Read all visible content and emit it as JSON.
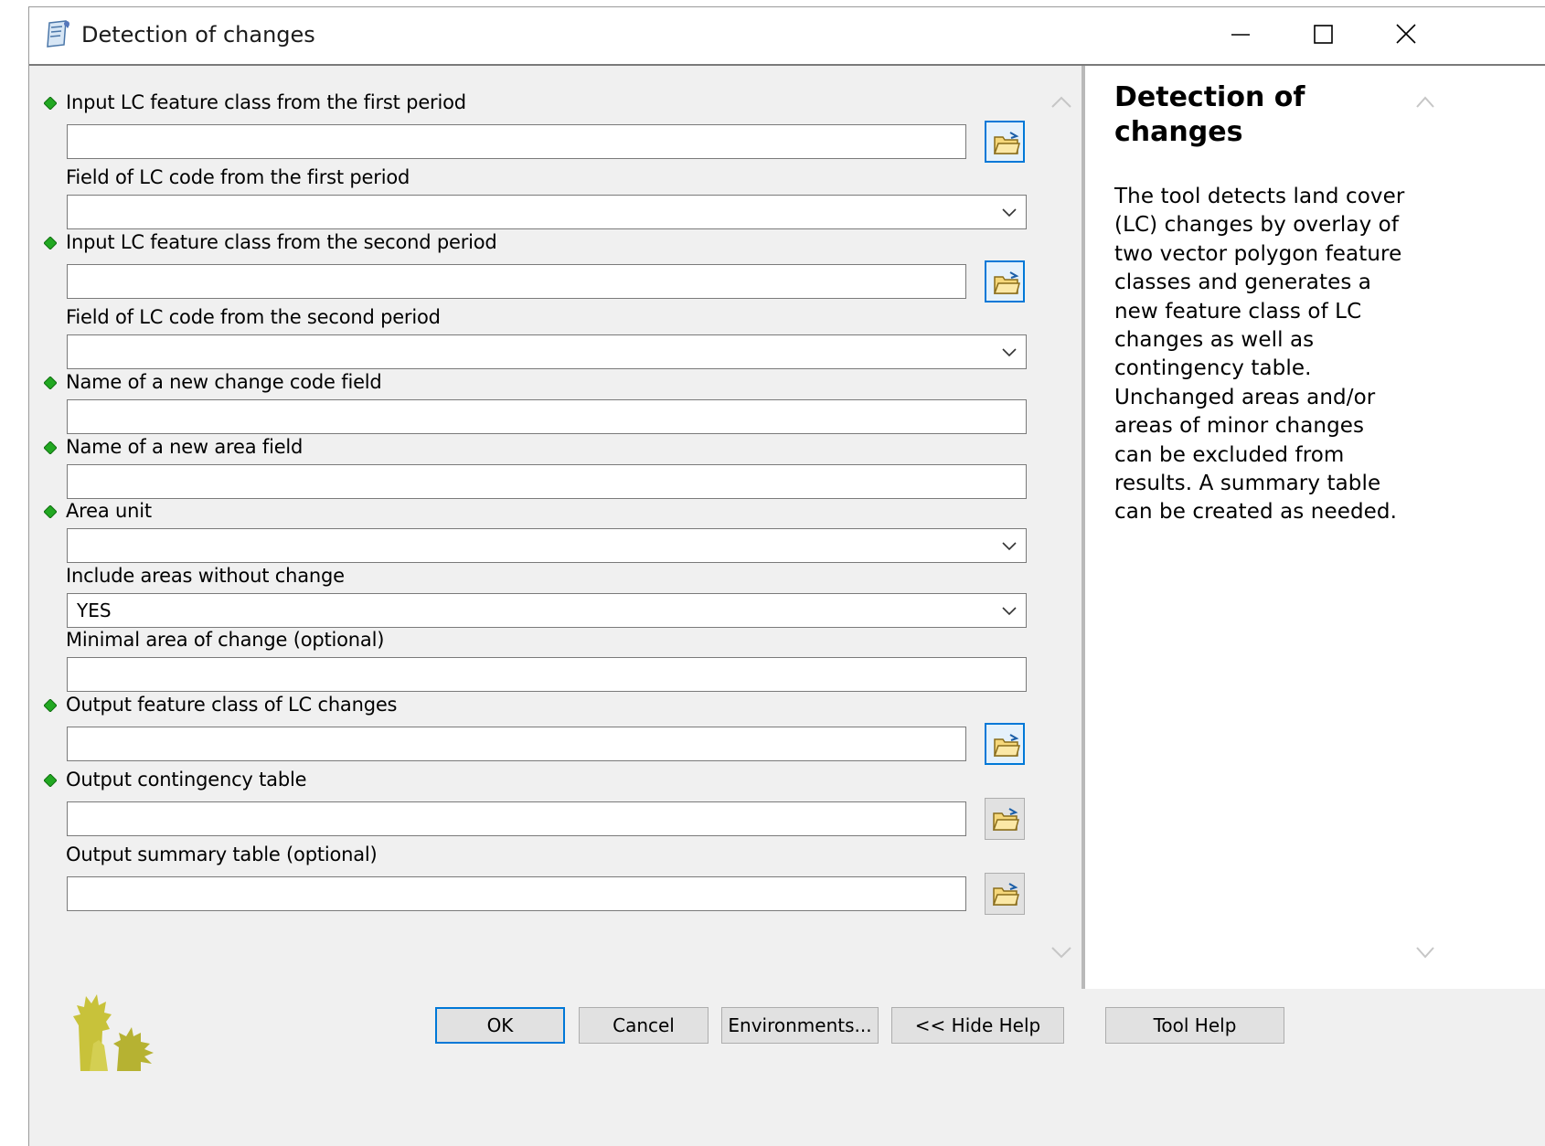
{
  "window": {
    "title": "Detection of changes",
    "controls": {
      "minimize": "minimize-icon",
      "maximize": "maximize-icon",
      "close": "close-icon"
    }
  },
  "params": [
    {
      "label": "Input LC feature class from the first period",
      "required": true,
      "control": "text+browse",
      "value": ""
    },
    {
      "label": "Field of LC code from the first period",
      "required": false,
      "control": "dropdown",
      "value": ""
    },
    {
      "label": "Input LC feature class from the second period",
      "required": true,
      "control": "text+browse",
      "value": ""
    },
    {
      "label": "Field of LC code from the second period",
      "required": false,
      "control": "dropdown",
      "value": ""
    },
    {
      "label": "Name of a new change code field",
      "required": true,
      "control": "text",
      "value": ""
    },
    {
      "label": "Name of a new area field",
      "required": true,
      "control": "text",
      "value": ""
    },
    {
      "label": "Area unit",
      "required": true,
      "control": "dropdown",
      "value": ""
    },
    {
      "label": "Include areas without change",
      "required": false,
      "control": "dropdown",
      "value": "YES"
    },
    {
      "label": "Minimal area of change (optional)",
      "required": false,
      "control": "text",
      "value": ""
    },
    {
      "label": "Output feature class of LC changes",
      "required": true,
      "control": "text+browse",
      "value": ""
    },
    {
      "label": "Output contingency table",
      "required": true,
      "control": "text+browse",
      "value": ""
    },
    {
      "label": "Output summary table (optional)",
      "required": false,
      "control": "text+browse",
      "value": ""
    }
  ],
  "help": {
    "title": "Detection of changes",
    "body": "The tool detects land cover (LC) changes by overlay of two vector polygon feature classes and generates a new feature class of LC changes as well as contingency table. Unchanged areas and/or areas of minor changes can be excluded from results. A summary table can be created as needed."
  },
  "buttons": {
    "ok": "OK",
    "cancel": "Cancel",
    "environments": "Environments...",
    "hide_help": "<< Hide Help",
    "tool_help": "Tool Help"
  },
  "colors": {
    "required_dot": "#22a822",
    "focus_border": "#0078d7",
    "panel_bg": "#f0f0f0"
  }
}
